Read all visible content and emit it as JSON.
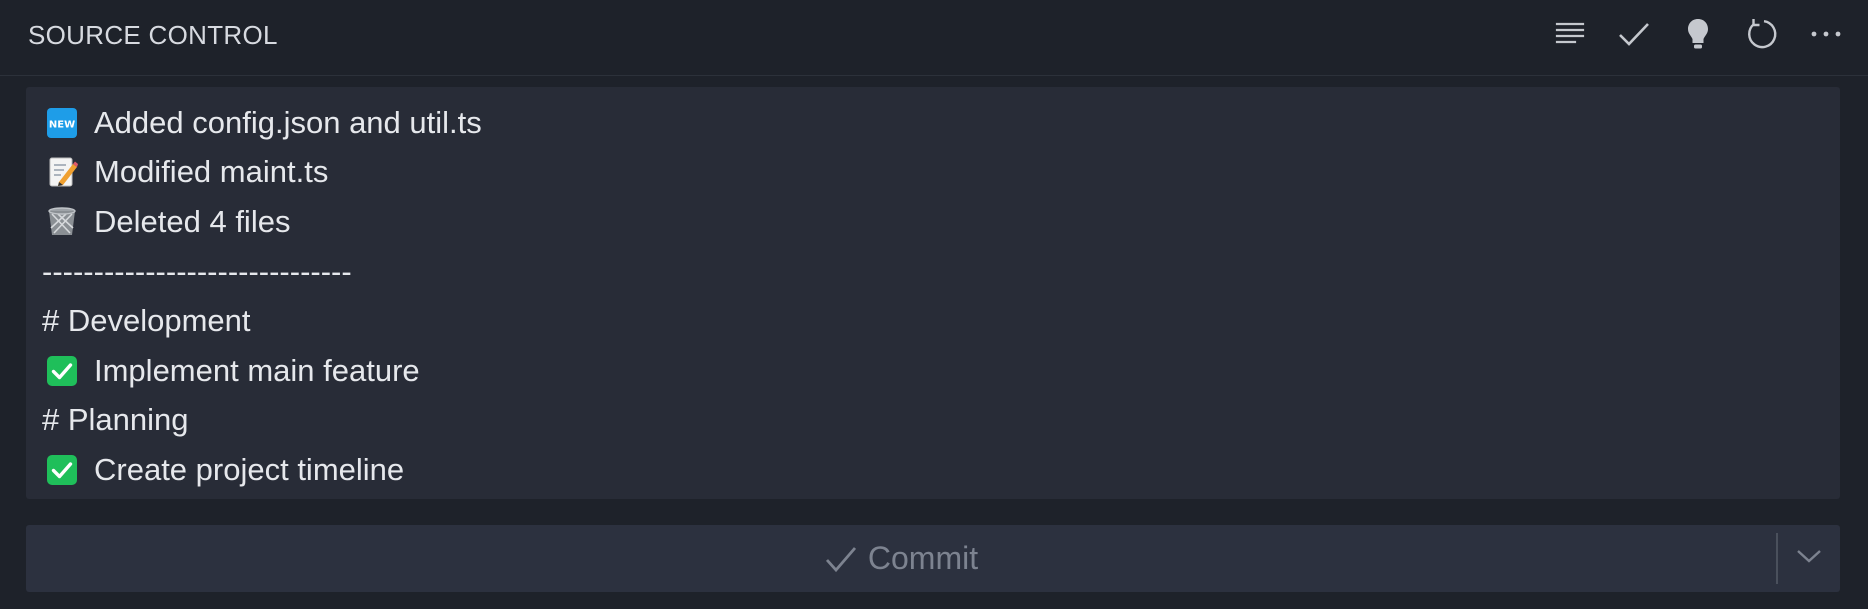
{
  "header": {
    "title": "SOURCE CONTROL",
    "actions": [
      {
        "name": "view-as-list",
        "icon": "list-lines-icon"
      },
      {
        "name": "commit",
        "icon": "check-icon"
      },
      {
        "name": "generate-message",
        "icon": "lightbulb-icon"
      },
      {
        "name": "refresh",
        "icon": "refresh-icon"
      },
      {
        "name": "more-actions",
        "icon": "ellipsis-icon"
      }
    ]
  },
  "message": {
    "lines": [
      {
        "icon": "new-badge-icon",
        "text": "Added config.json and util.ts"
      },
      {
        "icon": "memo-icon",
        "text": "Modified maint.ts"
      },
      {
        "icon": "wastebasket-icon",
        "text": "Deleted 4 files"
      },
      {
        "icon": "",
        "text": "------------------------------"
      },
      {
        "icon": "",
        "text": "# Development"
      },
      {
        "icon": "check-mark-button-icon",
        "text": "Implement main feature"
      },
      {
        "icon": "",
        "text": "# Planning"
      },
      {
        "icon": "check-mark-button-icon",
        "text": "Create project timeline"
      }
    ]
  },
  "commit_button": {
    "label": "Commit",
    "icon": "check-icon",
    "dropdown_icon": "chevron-down-icon"
  },
  "colors": {
    "background": "#1e222a",
    "input_background": "#282c37",
    "button_background": "#2c313f",
    "text": "#e6e8ec",
    "muted_text": "#7d8390"
  }
}
